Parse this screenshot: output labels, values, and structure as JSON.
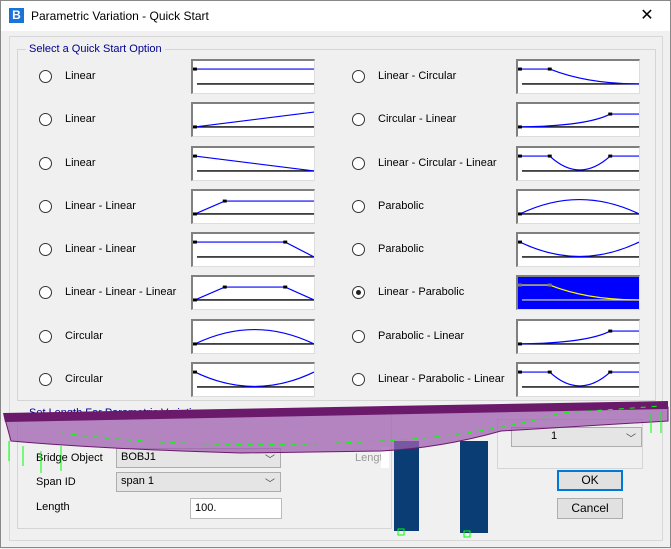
{
  "window": {
    "title": "Parametric Variation - Quick Start",
    "app_icon": "B",
    "close": "✕"
  },
  "quick_start": {
    "label": "Select a Quick Start Option",
    "options": [
      {
        "label": "Linear",
        "profile": "flat",
        "selected": false
      },
      {
        "label": "Linear",
        "profile": "rise",
        "selected": false
      },
      {
        "label": "Linear",
        "profile": "fall",
        "selected": false
      },
      {
        "label": "Linear - Linear",
        "profile": "rise-flat",
        "selected": false
      },
      {
        "label": "Linear - Linear",
        "profile": "flat-fall",
        "selected": false
      },
      {
        "label": "Linear - Linear - Linear",
        "profile": "rise-flat-fall",
        "selected": false
      },
      {
        "label": "Circular",
        "profile": "arc-up",
        "selected": false
      },
      {
        "label": "Circular",
        "profile": "arc-down",
        "selected": false
      },
      {
        "label": "Linear - Circular",
        "profile": "flat-curve-down",
        "selected": false
      },
      {
        "label": "Circular - Linear",
        "profile": "curve-up-flat",
        "selected": false
      },
      {
        "label": "Linear - Circular - Linear",
        "profile": "flat-sag-flat",
        "selected": false
      },
      {
        "label": "Parabolic",
        "profile": "arc-up",
        "selected": false
      },
      {
        "label": "Parabolic",
        "profile": "arc-down",
        "selected": false
      },
      {
        "label": "Linear - Parabolic",
        "profile": "flat-curve-down",
        "selected": true
      },
      {
        "label": "Parabolic - Linear",
        "profile": "curve-up-flat",
        "selected": false
      },
      {
        "label": "Linear - Parabolic - Linear",
        "profile": "flat-sag-flat",
        "selected": false
      }
    ]
  },
  "set_length": {
    "label": "Set Length For Parametric Variation",
    "bridge_object_label": "Bridge Object",
    "bridge_object_value": "BOBJ1",
    "span_id_label": "Span ID",
    "span_id_value": "span 1",
    "length_label": "Length",
    "length_value": "100.",
    "length_label_2": "Length",
    "right_combo_value": "1"
  },
  "buttons": {
    "ok": "OK",
    "cancel": "Cancel"
  },
  "colors": {
    "profile_line": "#0000ff",
    "selected_bg": "#0000ff",
    "selected_line": "#ffff00",
    "bridge_deck": "#8b2a8b",
    "pier": "#0a3d73"
  }
}
